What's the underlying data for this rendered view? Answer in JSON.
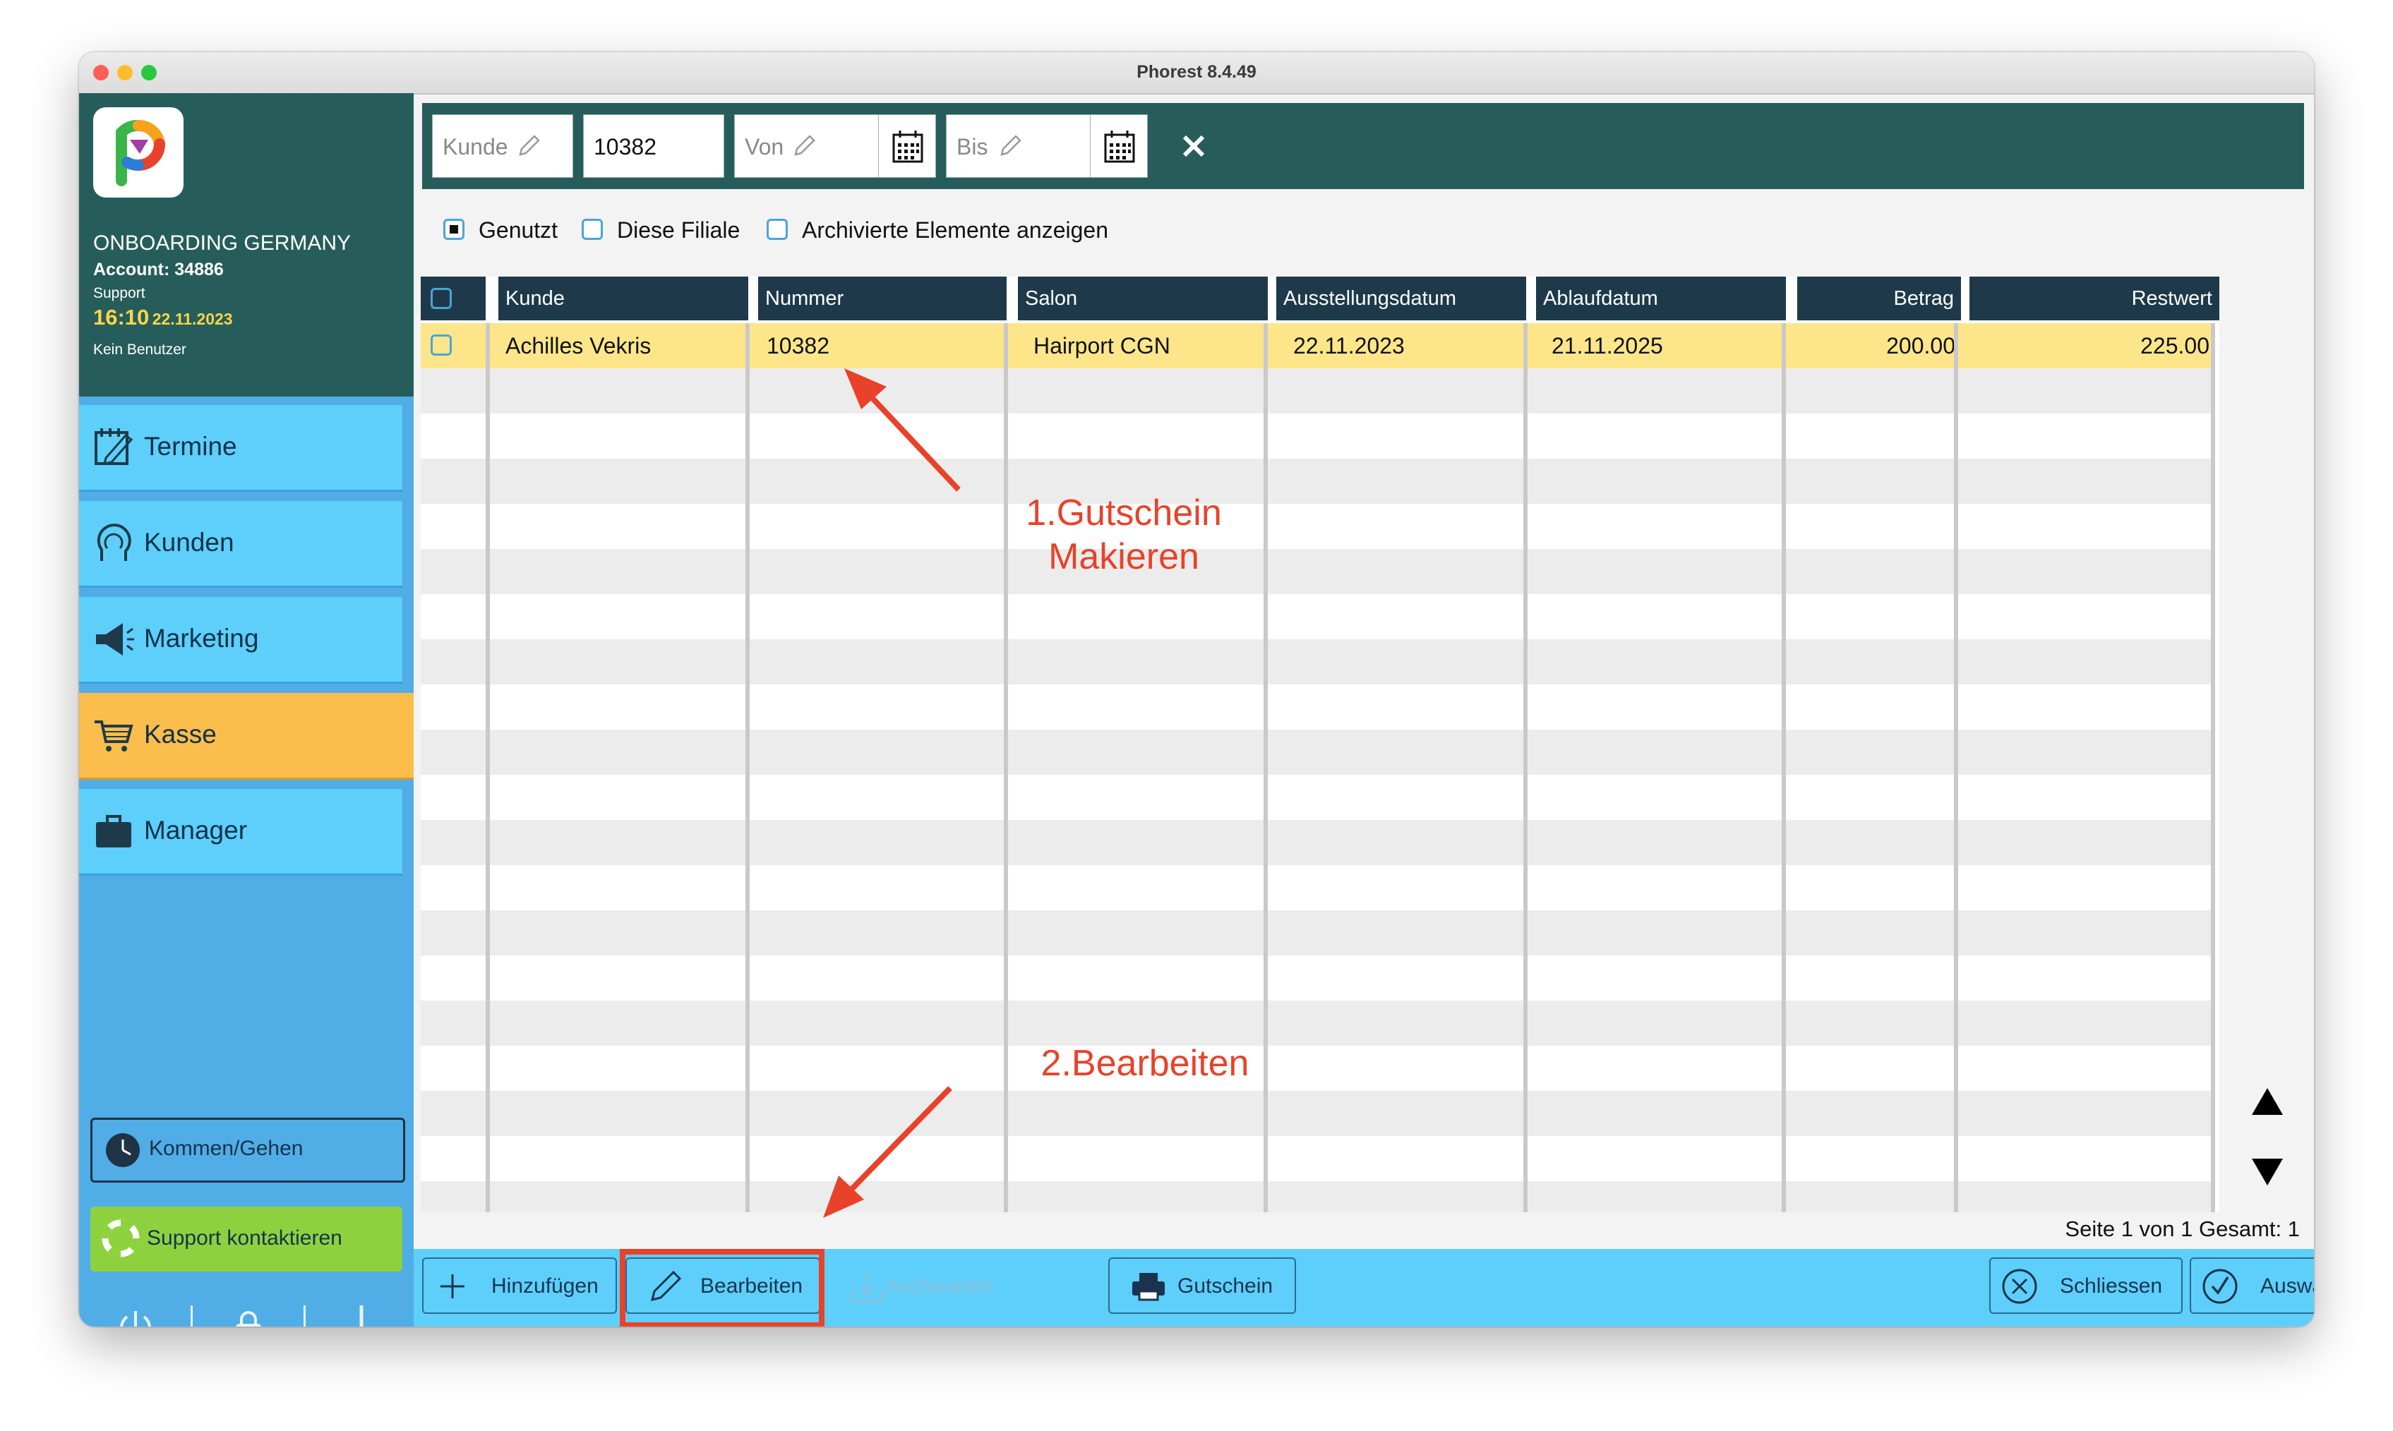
{
  "window": {
    "title": "Phorest 8.4.49"
  },
  "sidebar": {
    "org_name": "ONBOARDING GERMANY",
    "account": "Account: 34886",
    "role": "Support",
    "time": "16:10",
    "date": "22.11.2023",
    "user": "Kein Benutzer",
    "nav": [
      {
        "label": "Termine",
        "icon": "calendar-edit-icon"
      },
      {
        "label": "Kunden",
        "icon": "customer-head-icon"
      },
      {
        "label": "Marketing",
        "icon": "megaphone-icon"
      },
      {
        "label": "Kasse",
        "icon": "shopping-cart-icon",
        "active": true
      },
      {
        "label": "Manager",
        "icon": "briefcase-icon"
      }
    ],
    "kommen_gehen": "Kommen/Gehen",
    "support": "Support kontaktieren"
  },
  "filters": {
    "kunde_placeholder": "Kunde",
    "nummer_value": "10382",
    "von_placeholder": "Von",
    "bis_placeholder": "Bis"
  },
  "checkboxes": [
    {
      "label": "Genutzt",
      "checked": true
    },
    {
      "label": "Diese Filiale",
      "checked": false
    },
    {
      "label": "Archivierte Elemente anzeigen",
      "checked": false
    }
  ],
  "table": {
    "columns": [
      "Kunde",
      "Nummer",
      "Salon",
      "Ausstellungsdatum",
      "Ablaufdatum",
      "Betrag",
      "Restwert"
    ],
    "rows": [
      {
        "kunde": "Achilles Vekris",
        "nummer": "10382",
        "salon": "Hairport CGN",
        "ausstellungsdatum": "22.11.2023",
        "ablaufdatum": "21.11.2025",
        "betrag": "200.00",
        "restwert": "225.00",
        "selected": true
      }
    ]
  },
  "pager": "Seite 1 von 1 Gesamt: 1",
  "buttons": {
    "add": "Hinzufügen",
    "edit": "Bearbeiten",
    "archive": "Archivieren",
    "voucher": "Gutschein",
    "close": "Schliessen",
    "select": "Auswählen"
  },
  "annotations": {
    "step1_line1": "1.Gutschein",
    "step1_line2": "Makieren",
    "step2": "2.Bearbeiten",
    "color": "#e8422a"
  },
  "colors": {
    "header_teal": "#265d5a",
    "nav_blue": "#5dcffa",
    "active_orange": "#fbbd4b",
    "selected_row": "#fde68a"
  }
}
